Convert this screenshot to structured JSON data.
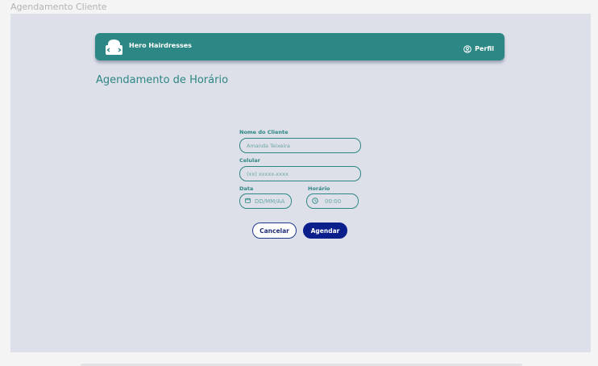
{
  "frame": {
    "title": "Agendamento Cliente"
  },
  "navbar": {
    "brand": "Hero Hairdresses",
    "brand_icon": "face-icon",
    "profile_label": "Perfil",
    "profile_icon": "user-circle-icon"
  },
  "page": {
    "title": "Agendamento de Horário"
  },
  "form": {
    "name_label": "Nome do Cliente",
    "name_placeholder": "Amanda Teixeira",
    "phone_label": "Celular",
    "phone_placeholder": "(xx) xxxxx-xxxx",
    "date_label": "Data",
    "date_placeholder": "DD/MM/AA",
    "date_icon": "calendar-icon",
    "time_label": "Horário",
    "time_placeholder": "00:00",
    "time_icon": "clock-icon",
    "cancel_label": "Cancelar",
    "submit_label": "Agendar"
  },
  "colors": {
    "primary": "#2d8784",
    "background": "#dddfe9",
    "submit": "#0b1f8c"
  }
}
